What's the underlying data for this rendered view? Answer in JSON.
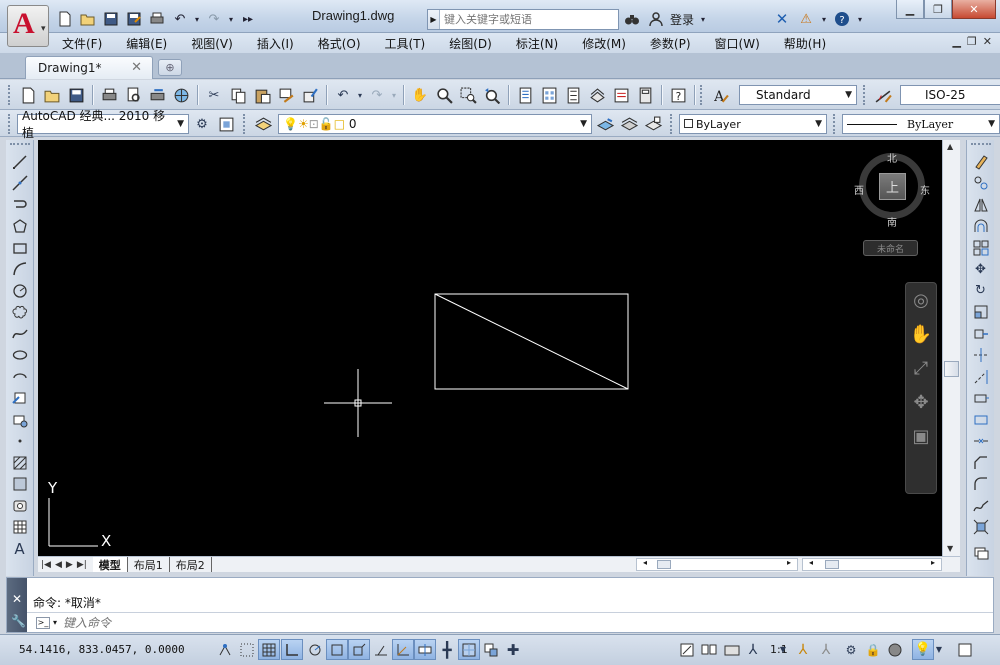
{
  "window": {
    "doc_title": "Drawing1.dwg",
    "search_placeholder": "键入关键字或短语",
    "login_label": "登录",
    "help_icon": "help-icon"
  },
  "menu": [
    "文件(F)",
    "编辑(E)",
    "视图(V)",
    "插入(I)",
    "格式(O)",
    "工具(T)",
    "绘图(D)",
    "标注(N)",
    "修改(M)",
    "参数(P)",
    "窗口(W)",
    "帮助(H)"
  ],
  "tabs": {
    "active": "Drawing1*"
  },
  "toolbar": {
    "text_style": "Standard",
    "dim_style": "ISO-25",
    "workspace": "AutoCAD 经典... 2010 移植",
    "layer": "0",
    "color": "ByLayer",
    "linetype": "ByLayer"
  },
  "viewcube": {
    "north": "北",
    "south": "南",
    "east": "东",
    "west": "西",
    "face": "上",
    "ucs_label": "未命名"
  },
  "ucs": {
    "y_label": "Y",
    "x_label": "X"
  },
  "layout_tabs": [
    "模型",
    "布局1",
    "布局2"
  ],
  "command": {
    "history": "命令:  *取消*",
    "placeholder": "键入命令"
  },
  "status": {
    "coords": "54.1416,   833.0457,  0.0000",
    "annotation_scale": "1:1"
  },
  "colors": {
    "canvas_bg": "#000000",
    "geometry": "#ffffff",
    "brand_red": "#c8102e"
  }
}
